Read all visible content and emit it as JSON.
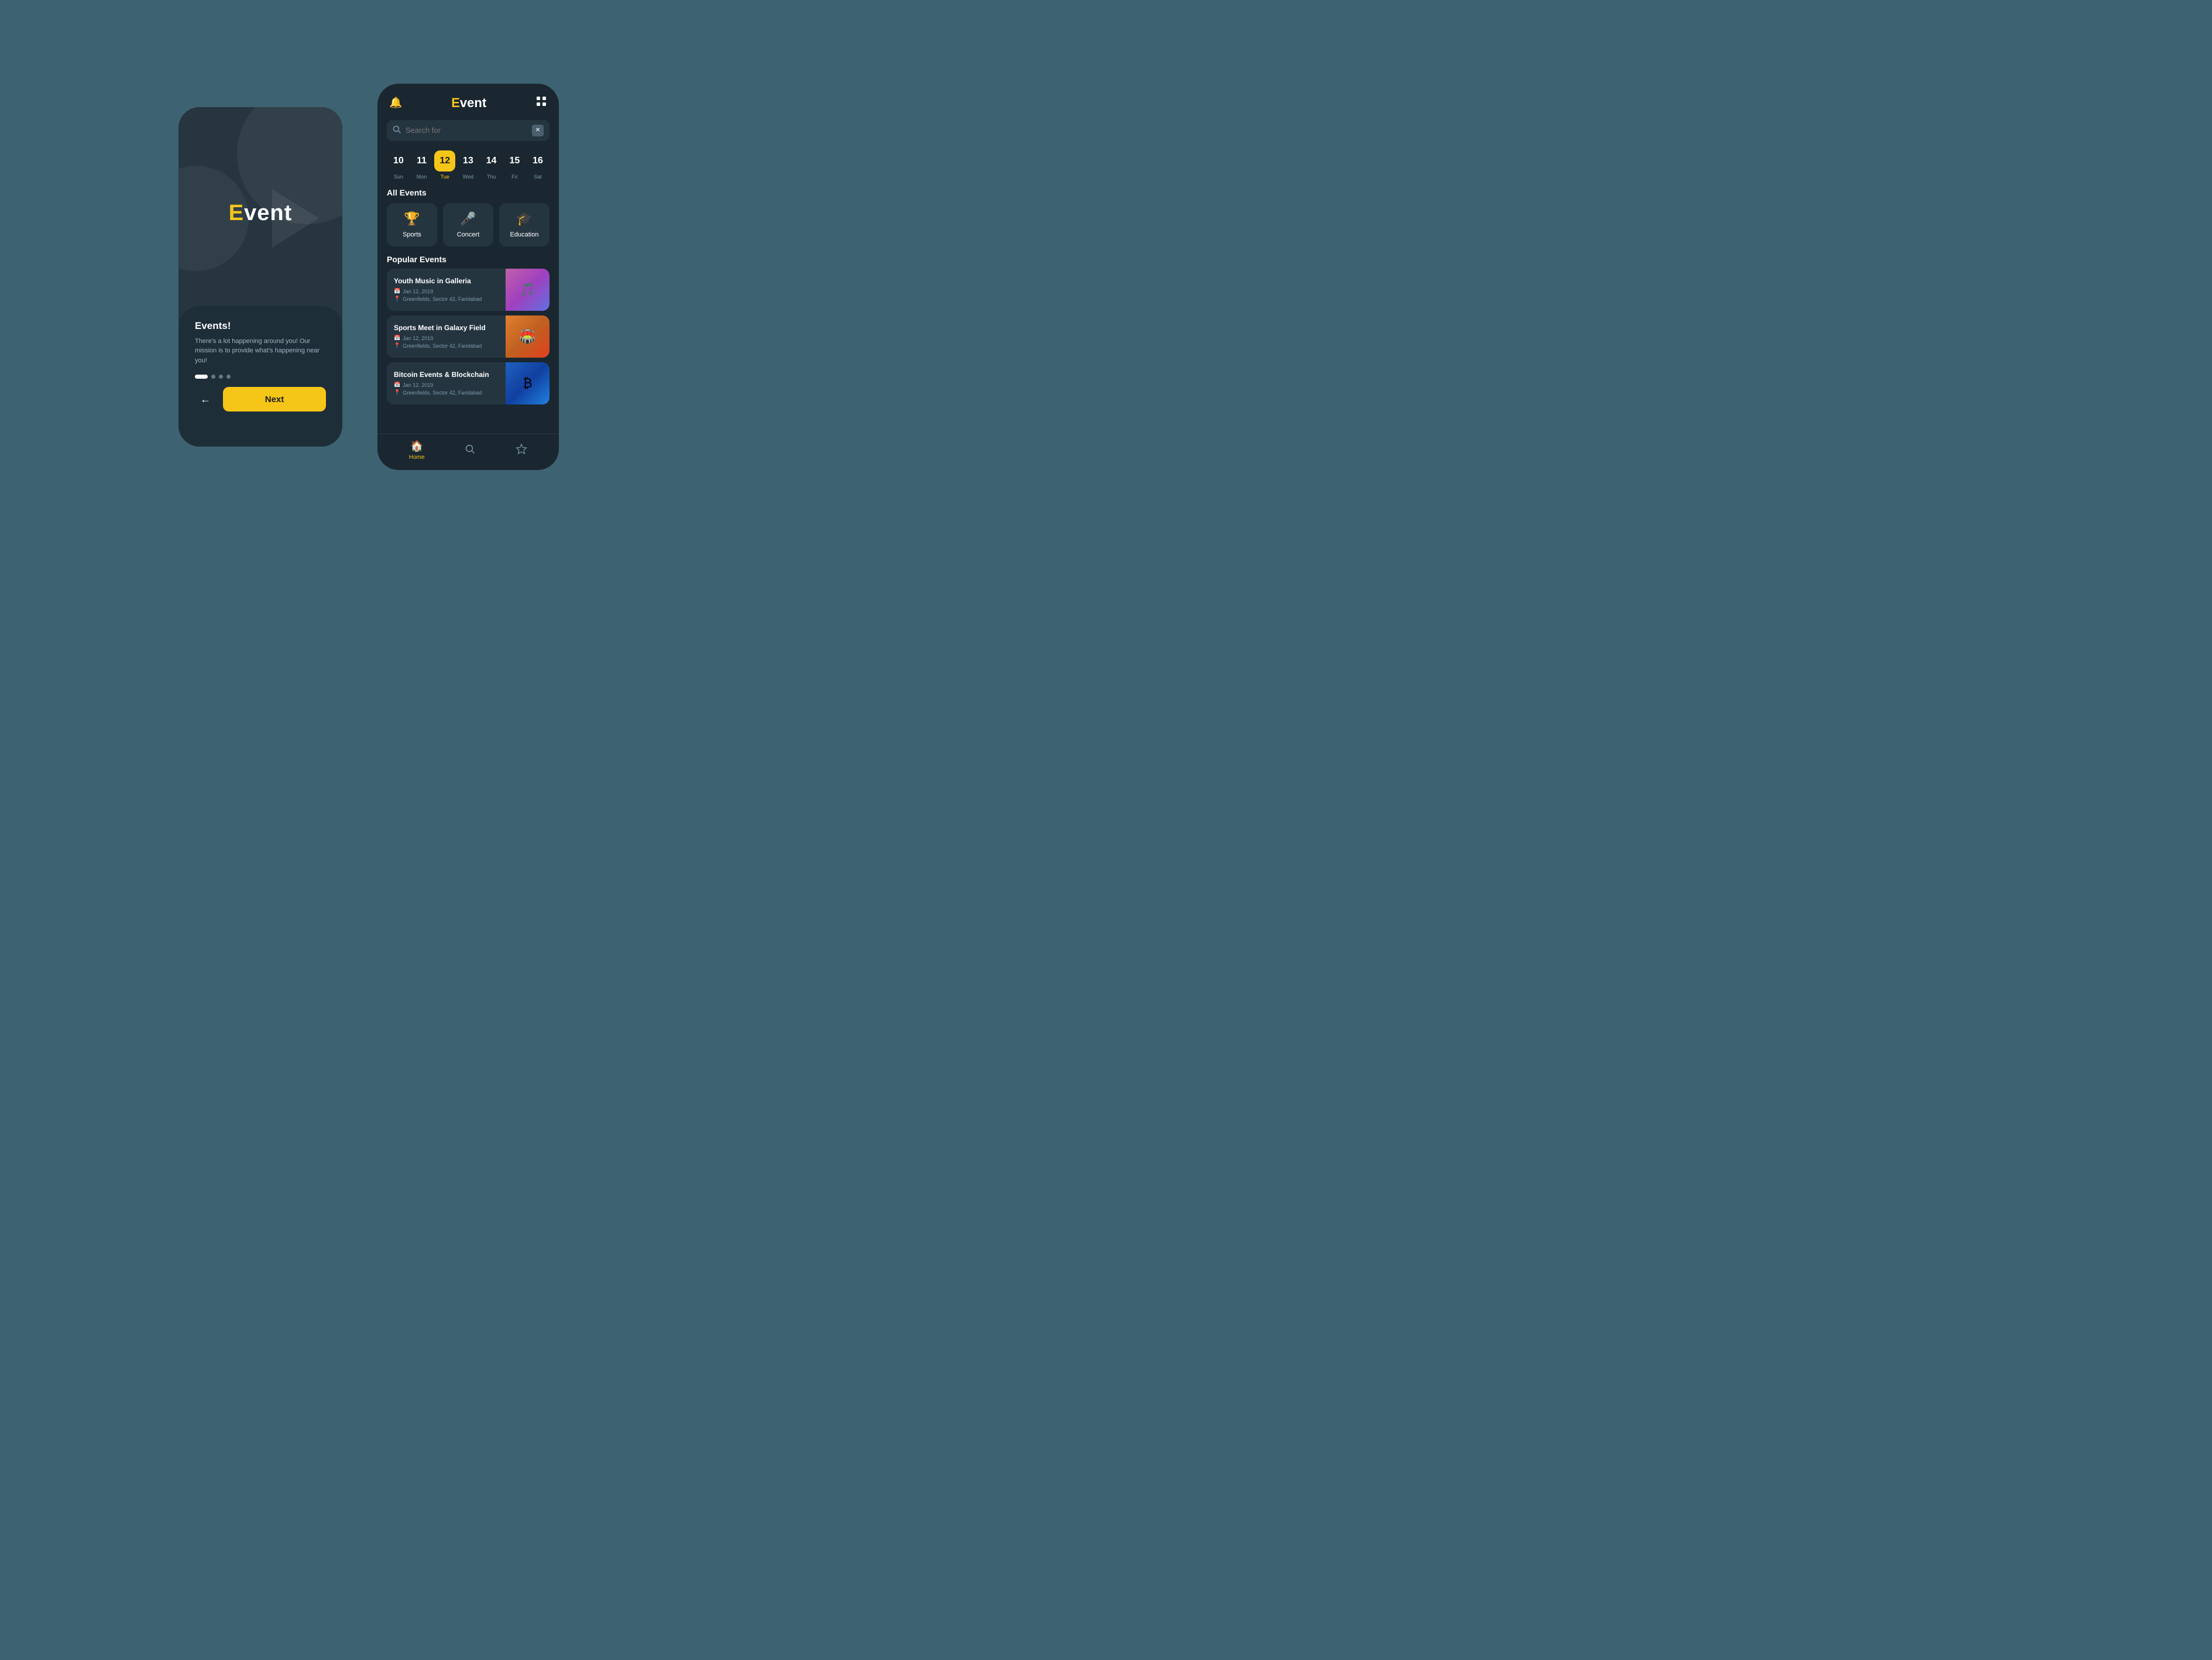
{
  "background_color": "#3d6272",
  "onboarding": {
    "logo": {
      "e_letter": "E",
      "rest": "vent"
    },
    "headline": "Events!",
    "subtext": "There's a lot happening around you! Our mission is to provide what's happening near you!",
    "dots": [
      "active",
      "inactive",
      "inactive",
      "inactive"
    ],
    "back_label": "←",
    "next_label": "Next"
  },
  "app": {
    "header": {
      "bell_icon": "🔔",
      "logo": {
        "e_letter": "E",
        "rest": "vent"
      },
      "grid_icon": "⊞"
    },
    "search": {
      "placeholder": "Search for",
      "clear_icon": "✕"
    },
    "calendar": {
      "days": [
        {
          "num": "10",
          "name": "Sun",
          "active": false
        },
        {
          "num": "11",
          "name": "Mon",
          "active": false
        },
        {
          "num": "12",
          "name": "Tue",
          "active": true
        },
        {
          "num": "13",
          "name": "Wed",
          "active": false
        },
        {
          "num": "14",
          "name": "Thu",
          "active": false
        },
        {
          "num": "15",
          "name": "Fri",
          "active": false
        },
        {
          "num": "16",
          "name": "Sat",
          "active": false
        }
      ]
    },
    "all_events_label": "All Events",
    "categories": [
      {
        "icon": "🏆",
        "label": "Sports"
      },
      {
        "icon": "🎤",
        "label": "Concert"
      },
      {
        "icon": "🎓",
        "label": "Education"
      }
    ],
    "popular_label": "Popular Events",
    "events": [
      {
        "title": "Youth Music in Galleria",
        "date": "Jan 12, 2019",
        "location": "Greenfields, Sector 42, Faridabad",
        "img_type": "music"
      },
      {
        "title": "Sports Meet in Galaxy Field",
        "date": "Jan 12, 2019",
        "location": "Greenfields, Sector 42, Faridabad",
        "img_type": "sports"
      },
      {
        "title": "Bitcoin Events & Blockchain",
        "date": "Jan 12, 2019",
        "location": "Greenfields, Sector 42, Faridabad",
        "img_type": "bitcoin"
      }
    ],
    "bottom_nav": [
      {
        "icon": "🏠",
        "label": "Home",
        "active": true
      },
      {
        "icon": "🔍",
        "label": "",
        "active": false
      },
      {
        "icon": "☆",
        "label": "",
        "active": false
      }
    ]
  }
}
